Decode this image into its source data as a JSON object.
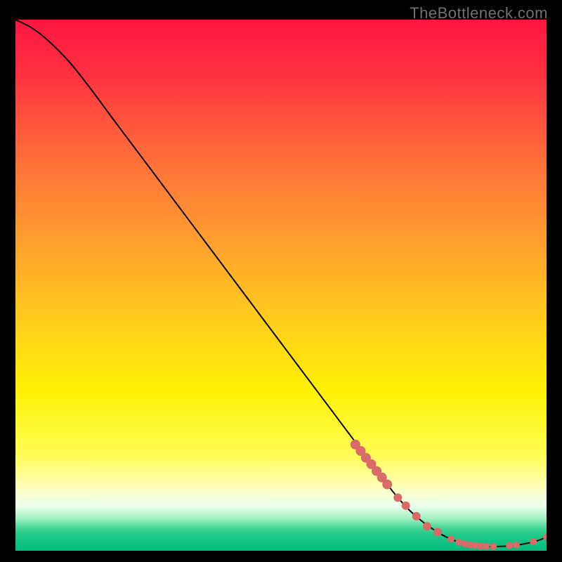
{
  "watermark": "TheBottleneck.com",
  "colors": {
    "bg": "#000000",
    "curve": "#000000",
    "marker_fill": "#d86a68",
    "marker_stroke": "#b24f4d",
    "watermark": "#707070"
  },
  "chart_data": {
    "type": "line",
    "title": "",
    "xlabel": "",
    "ylabel": "",
    "xlim": [
      0,
      100
    ],
    "ylim": [
      0,
      100
    ],
    "gradient_stops": [
      {
        "offset": 0.0,
        "color": "#ff163f"
      },
      {
        "offset": 0.1,
        "color": "#ff3040"
      },
      {
        "offset": 0.25,
        "color": "#ff6a3a"
      },
      {
        "offset": 0.4,
        "color": "#ff9a30"
      },
      {
        "offset": 0.55,
        "color": "#ffc81e"
      },
      {
        "offset": 0.7,
        "color": "#fff205"
      },
      {
        "offset": 0.82,
        "color": "#fffd55"
      },
      {
        "offset": 0.88,
        "color": "#ffffbb"
      },
      {
        "offset": 0.915,
        "color": "#eefff0"
      },
      {
        "offset": 0.94,
        "color": "#a0f0c0"
      },
      {
        "offset": 0.955,
        "color": "#4dd89a"
      },
      {
        "offset": 0.97,
        "color": "#20c98a"
      },
      {
        "offset": 1.0,
        "color": "#00bb7a"
      }
    ],
    "series": [
      {
        "name": "curve",
        "x": [
          0,
          3,
          6,
          10,
          14,
          18,
          24,
          30,
          36,
          42,
          48,
          54,
          60,
          66,
          72,
          76,
          80,
          83,
          86,
          90,
          94,
          98,
          100
        ],
        "y": [
          100,
          98.5,
          96.2,
          92.2,
          87.2,
          81.8,
          73.8,
          65.8,
          57.8,
          49.8,
          41.8,
          33.8,
          25.8,
          17.8,
          10.0,
          6.0,
          3.2,
          1.8,
          1.0,
          0.8,
          1.0,
          1.8,
          2.6
        ]
      }
    ],
    "markers": [
      {
        "x": 64.0,
        "y": 20.0,
        "r": 7
      },
      {
        "x": 65.0,
        "y": 18.8,
        "r": 7
      },
      {
        "x": 66.0,
        "y": 17.5,
        "r": 7
      },
      {
        "x": 67.0,
        "y": 16.3,
        "r": 7
      },
      {
        "x": 68.0,
        "y": 15.0,
        "r": 7
      },
      {
        "x": 69.0,
        "y": 13.8,
        "r": 7
      },
      {
        "x": 70.0,
        "y": 12.5,
        "r": 7
      },
      {
        "x": 72.0,
        "y": 10.0,
        "r": 6
      },
      {
        "x": 73.5,
        "y": 8.5,
        "r": 6
      },
      {
        "x": 75.5,
        "y": 6.5,
        "r": 6
      },
      {
        "x": 77.5,
        "y": 4.6,
        "r": 6
      },
      {
        "x": 79.5,
        "y": 3.5,
        "r": 6
      },
      {
        "x": 82.0,
        "y": 2.2,
        "r": 5
      },
      {
        "x": 83.5,
        "y": 1.6,
        "r": 5
      },
      {
        "x": 84.6,
        "y": 1.3,
        "r": 5
      },
      {
        "x": 85.6,
        "y": 1.1,
        "r": 5
      },
      {
        "x": 86.6,
        "y": 1.0,
        "r": 5
      },
      {
        "x": 87.6,
        "y": 0.9,
        "r": 5
      },
      {
        "x": 88.6,
        "y": 0.85,
        "r": 5
      },
      {
        "x": 90.0,
        "y": 0.8,
        "r": 5
      },
      {
        "x": 93.0,
        "y": 1.0,
        "r": 5
      },
      {
        "x": 94.3,
        "y": 1.1,
        "r": 5
      },
      {
        "x": 97.5,
        "y": 1.7,
        "r": 5
      },
      {
        "x": 100.0,
        "y": 2.6,
        "r": 5
      }
    ]
  }
}
